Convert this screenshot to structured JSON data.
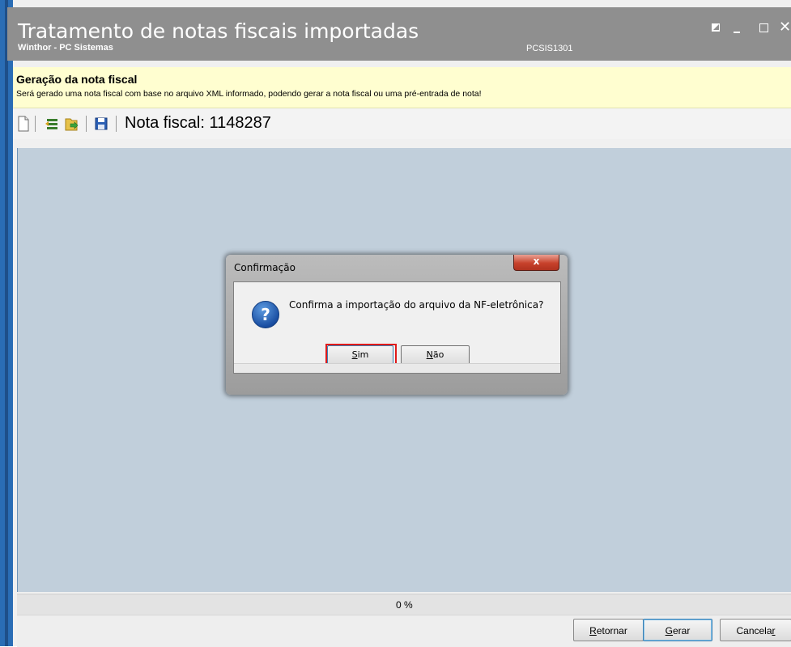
{
  "window": {
    "title": "Tratamento de notas fiscais importadas",
    "subtitle": "Winthor - PC Sistemas",
    "code": "PCSIS1301",
    "controls": {
      "close_glyph": "✕"
    }
  },
  "header": {
    "heading": "Geração da nota fiscal",
    "description": "Será gerado uma nota fiscal com base no arquivo XML informado, podendo gerar a nota fiscal ou uma pré-entrada de nota!"
  },
  "toolbar": {
    "icons": [
      "new-document-icon",
      "import-icon",
      "export-icon",
      "save-icon"
    ],
    "nota_fiscal_label": "Nota fiscal: 1148287"
  },
  "progress": {
    "text": "0 %",
    "value": 0
  },
  "footer": {
    "retornar_prefix": "",
    "retornar_key": "R",
    "retornar_rest": "etornar",
    "gerar_prefix": "",
    "gerar_key": "G",
    "gerar_rest": "erar",
    "cancelar_prefix": "Cancela",
    "cancelar_key": "r",
    "cancelar_rest": ""
  },
  "dialog": {
    "title": "Confirmação",
    "close_glyph": "x",
    "icon": "question-icon",
    "icon_glyph": "?",
    "message": "Confirma a importação do arquivo da NF-eletrônica?",
    "sim_key": "S",
    "sim_rest": "im",
    "nao_key": "N",
    "nao_rest": "ão"
  },
  "colors": {
    "titlebar": "#8f8f8f",
    "header_bg": "#fffed0",
    "content_bg": "#c1cfdb",
    "highlight": "#e01a1a"
  }
}
